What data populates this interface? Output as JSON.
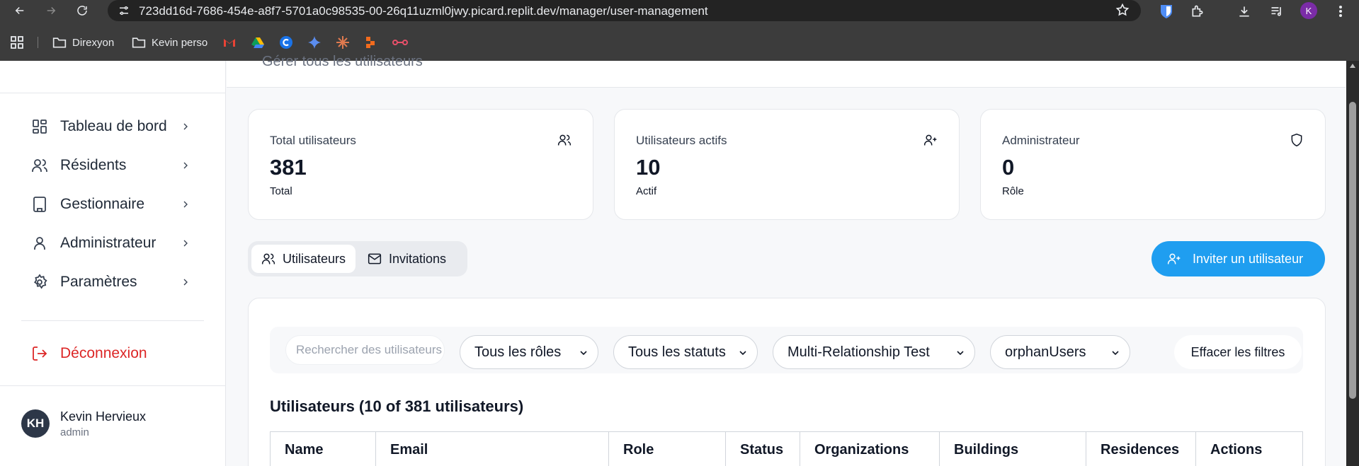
{
  "browser": {
    "url": "723dd16d-7686-454e-a8f7-5701a0c98535-00-26q11uzml0jwy.picard.replit.dev/manager/user-management",
    "profile_initial": "K",
    "bookmarks": [
      {
        "label": "Direxyon",
        "icon": "folder-icon"
      },
      {
        "label": "Kevin perso",
        "icon": "folder-icon"
      }
    ],
    "bookmark_icons": [
      "gmail-icon",
      "drive-icon",
      "c-app-icon",
      "gemini-icon",
      "claude-icon",
      "app-icon",
      "link-icon"
    ]
  },
  "sidebar": {
    "items": [
      {
        "label": "Tableau de bord",
        "icon": "dashboard-icon"
      },
      {
        "label": "Résidents",
        "icon": "users-icon"
      },
      {
        "label": "Gestionnaire",
        "icon": "building-icon"
      },
      {
        "label": "Administrateur",
        "icon": "user-icon"
      },
      {
        "label": "Paramètres",
        "icon": "gear-icon"
      }
    ],
    "logout_label": "Déconnexion",
    "user": {
      "initials": "KH",
      "name": "Kevin Hervieux",
      "role": "admin"
    }
  },
  "header": {
    "subtitle": "Gérer tous les utilisateurs"
  },
  "stats": [
    {
      "label": "Total utilisateurs",
      "value": "381",
      "sub": "Total",
      "icon": "users-icon"
    },
    {
      "label": "Utilisateurs actifs",
      "value": "10",
      "sub": "Actif",
      "icon": "user-plus-icon"
    },
    {
      "label": "Administrateur",
      "value": "0",
      "sub": "Rôle",
      "icon": "shield-icon"
    }
  ],
  "tabs": [
    {
      "label": "Utilisateurs",
      "icon": "users-icon",
      "active": true
    },
    {
      "label": "Invitations",
      "icon": "mail-icon",
      "active": false
    }
  ],
  "invite_button": {
    "label": "Inviter un utilisateur"
  },
  "filters": {
    "search_placeholder": "Rechercher des utilisateurs",
    "role": "Tous les rôles",
    "status": "Tous les statuts",
    "organization": "Multi-Relationship Test",
    "building": "orphanUsers",
    "clear_label": "Effacer les filtres"
  },
  "table": {
    "title": "Utilisateurs (10 of 381 utilisateurs)",
    "columns": [
      "Name",
      "Email",
      "Role",
      "Status",
      "Organizations",
      "Buildings",
      "Residences",
      "Actions"
    ]
  },
  "colors": {
    "accent": "#1f9ef0",
    "danger": "#dc2626",
    "avatar": "#2d3748"
  }
}
